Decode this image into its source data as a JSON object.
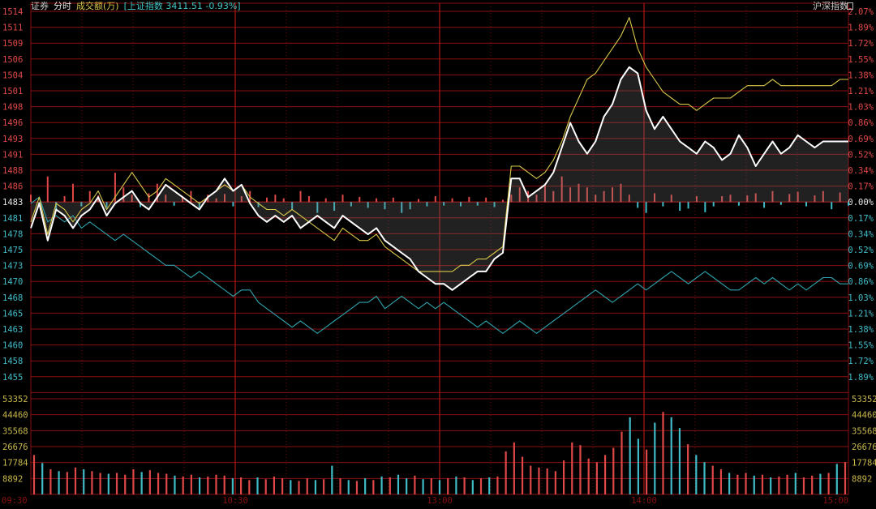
{
  "toolbar": {
    "sector_name": "证券",
    "mode": "分时",
    "volume_label": "成交额(万)",
    "index_label": "[上证指数 3411.51 -0.93%]",
    "right_label": "沪深指数"
  },
  "colors": {
    "background": "#000000",
    "grid": "#8a0f0f",
    "up": "#e04848",
    "down": "#3fbcc8",
    "neutral": "#e6e6e6",
    "main_line": "#ffffff",
    "yellow_line": "#d8c84a",
    "index_line": "#2fa3ad"
  },
  "chart_data": {
    "type": "line",
    "title": "",
    "price_axis": {
      "labels": [
        "1514",
        "1511",
        "1509",
        "1506",
        "1504",
        "1501",
        "1498",
        "1496",
        "1493",
        "1491",
        "1488",
        "1486",
        "1483",
        "1481",
        "1478",
        "1475",
        "1473",
        "1470",
        "1468",
        "1465",
        "1463",
        "1460",
        "1458",
        "1455"
      ],
      "prev_close": 1483,
      "ylim": [
        1455,
        1514
      ]
    },
    "percent_axis": {
      "labels": [
        "2.07%",
        "1.89%",
        "1.72%",
        "1.55%",
        "1.38%",
        "1.21%",
        "1.03%",
        "0.86%",
        "0.69%",
        "0.52%",
        "0.34%",
        "0.17%",
        "0.00%",
        "0.17%",
        "0.34%",
        "0.52%",
        "0.69%",
        "0.86%",
        "1.03%",
        "1.21%",
        "1.38%",
        "1.55%",
        "1.72%",
        "1.89%"
      ]
    },
    "volume_axis": {
      "labels": [
        "53352",
        "44460",
        "35568",
        "26676",
        "17784",
        "8892"
      ],
      "ylim": [
        0,
        53352
      ]
    },
    "time_labels": [
      "09:30",
      "10:30",
      "13:00",
      "14:00",
      "15:00"
    ],
    "series": [
      {
        "key": "price",
        "values": [
          1479,
          1483,
          1477,
          1482,
          1481,
          1479,
          1481,
          1482,
          1484,
          1481,
          1483,
          1484,
          1485,
          1483,
          1482,
          1484,
          1486,
          1485,
          1484,
          1483,
          1482,
          1484,
          1485,
          1487,
          1485,
          1486,
          1483,
          1481,
          1480,
          1481,
          1480,
          1481,
          1479,
          1480,
          1481,
          1480,
          1479,
          1481,
          1480,
          1479,
          1478,
          1479,
          1477,
          1476,
          1475,
          1474,
          1472,
          1471,
          1470,
          1470,
          1469,
          1470,
          1471,
          1472,
          1472,
          1474,
          1475,
          1487,
          1487,
          1484,
          1485,
          1486,
          1488,
          1492,
          1496,
          1493,
          1491,
          1493,
          1497,
          1499,
          1503,
          1505,
          1504,
          1498,
          1495,
          1497,
          1495,
          1493,
          1492,
          1491,
          1493,
          1492,
          1490,
          1491,
          1494,
          1492,
          1489,
          1491,
          1493,
          1491,
          1492,
          1494,
          1493,
          1492,
          1493,
          1493,
          1493,
          1493
        ]
      },
      {
        "key": "avg",
        "values": [
          1480,
          1484,
          1478,
          1483,
          1482,
          1480,
          1482,
          1483,
          1485,
          1482,
          1484,
          1486,
          1488,
          1486,
          1484,
          1485,
          1487,
          1486,
          1485,
          1484,
          1483,
          1484,
          1485,
          1486,
          1485,
          1486,
          1484,
          1483,
          1482,
          1482,
          1481,
          1482,
          1481,
          1480,
          1479,
          1478,
          1477,
          1479,
          1478,
          1477,
          1477,
          1478,
          1476,
          1475,
          1474,
          1473,
          1472,
          1472,
          1472,
          1472,
          1472,
          1473,
          1473,
          1474,
          1474,
          1475,
          1476,
          1489,
          1489,
          1488,
          1487,
          1488,
          1490,
          1493,
          1497,
          1500,
          1503,
          1504,
          1506,
          1508,
          1510,
          1513,
          1508,
          1505,
          1503,
          1501,
          1500,
          1499,
          1499,
          1498,
          1499,
          1500,
          1500,
          1500,
          1501,
          1502,
          1502,
          1502,
          1503,
          1502,
          1502,
          1502,
          1502,
          1502,
          1502,
          1502,
          1503,
          1503
        ]
      },
      {
        "key": "index",
        "values": [
          1483,
          1484,
          1480,
          1481,
          1480,
          1481,
          1479,
          1480,
          1479,
          1478,
          1477,
          1478,
          1477,
          1476,
          1475,
          1474,
          1473,
          1473,
          1472,
          1471,
          1472,
          1471,
          1470,
          1469,
          1468,
          1469,
          1469,
          1467,
          1466,
          1465,
          1464,
          1463,
          1464,
          1463,
          1462,
          1463,
          1464,
          1465,
          1466,
          1467,
          1467,
          1468,
          1466,
          1467,
          1468,
          1467,
          1466,
          1467,
          1466,
          1467,
          1466,
          1465,
          1464,
          1463,
          1464,
          1463,
          1462,
          1463,
          1464,
          1463,
          1462,
          1463,
          1464,
          1465,
          1466,
          1467,
          1468,
          1469,
          1468,
          1467,
          1468,
          1469,
          1470,
          1469,
          1470,
          1471,
          1472,
          1471,
          1470,
          1471,
          1472,
          1471,
          1470,
          1469,
          1469,
          1470,
          1471,
          1470,
          1471,
          1470,
          1469,
          1470,
          1469,
          1470,
          1471,
          1471,
          1470,
          1470
        ]
      },
      {
        "key": "volume",
        "values": [
          22000,
          17500,
          14000,
          13000,
          12500,
          15000,
          14000,
          13000,
          12000,
          11500,
          12000,
          11000,
          14000,
          12500,
          13500,
          12000,
          11500,
          10500,
          10000,
          11000,
          9500,
          10000,
          11000,
          10500,
          9000,
          9500,
          8000,
          9500,
          8500,
          10000,
          9000,
          8000,
          7500,
          9000,
          8000,
          8500,
          16000,
          9000,
          8000,
          7500,
          9000,
          8000,
          10000,
          9500,
          11000,
          9000,
          10500,
          8500,
          9000,
          8000,
          9000,
          10000,
          9500,
          8000,
          9000,
          9500,
          10000,
          24000,
          29000,
          21000,
          16000,
          15000,
          14500,
          13000,
          19000,
          29000,
          27500,
          20000,
          18000,
          22000,
          26000,
          35000,
          43000,
          31000,
          25000,
          40000,
          46000,
          43000,
          37000,
          28000,
          22000,
          18000,
          16000,
          14000,
          12000,
          11000,
          12000,
          10500,
          11000,
          9500,
          10000,
          11000,
          12000,
          9500,
          10500,
          11500,
          12000,
          17000,
          18000
        ]
      },
      {
        "key": "mini",
        "values": [
          1.0,
          -0.5,
          3.5,
          -1.2,
          0.8,
          2.5,
          -0.6,
          1.5,
          0.9,
          -0.8,
          4.0,
          2.0,
          1.0,
          -0.7,
          1.2,
          2.5,
          1.0,
          -0.5,
          0.8,
          1.5,
          -0.8,
          1.0,
          0.5,
          1.1,
          -0.6,
          0.8,
          1.5,
          -0.7,
          0.6,
          1.0,
          0.5,
          -1.0,
          1.5,
          0.8,
          -1.5,
          0.5,
          -1.2,
          1.0,
          -0.6,
          0.7,
          -0.8,
          0.5,
          -1.0,
          0.6,
          -1.5,
          -1.0,
          0.4,
          -0.6,
          0.8,
          -0.5,
          0.5,
          -0.6,
          0.7,
          -0.5,
          0.6,
          -0.7,
          0.3,
          1.0,
          2.0,
          1.5,
          1.0,
          2.5,
          1.5,
          3.5,
          2.0,
          2.5,
          2.0,
          1.0,
          1.5,
          2.0,
          2.5,
          1.0,
          -0.8,
          -1.5,
          1.2,
          -0.6,
          1.0,
          -1.2,
          -0.9,
          0.8,
          -1.4,
          -0.6,
          0.8,
          1.0,
          -0.5,
          0.9,
          1.2,
          -0.8,
          1.5,
          -0.4,
          1.1,
          1.4,
          -0.6,
          0.9,
          1.5,
          -1.0,
          1.3,
          -0.5
        ]
      }
    ]
  }
}
